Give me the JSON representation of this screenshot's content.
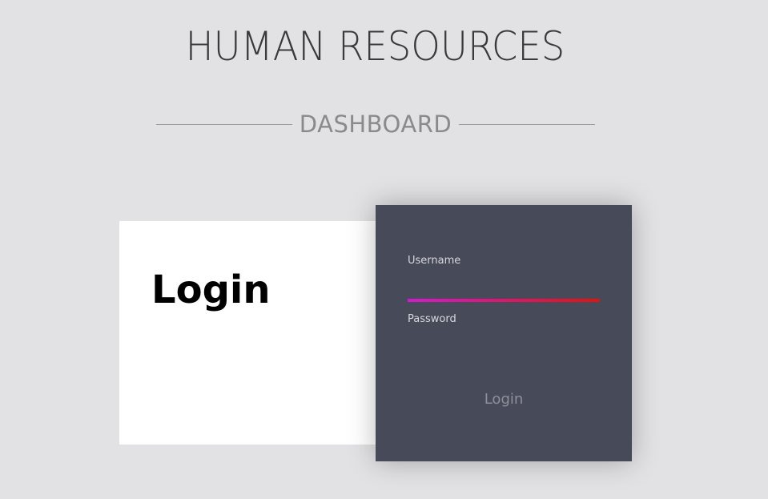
{
  "header": {
    "title": "HUMAN RESOURCES",
    "subtitle": "DASHBOARD"
  },
  "left_panel": {
    "title": "Login"
  },
  "form": {
    "username_label": "Username",
    "username_value": "",
    "password_label": "Password",
    "password_value": "",
    "submit_label": "Login"
  },
  "colors": {
    "background": "#e2e2e4",
    "form_panel": "#474a59",
    "focus_gradient_start": "#d21ad0",
    "focus_gradient_end": "#e0140c"
  }
}
